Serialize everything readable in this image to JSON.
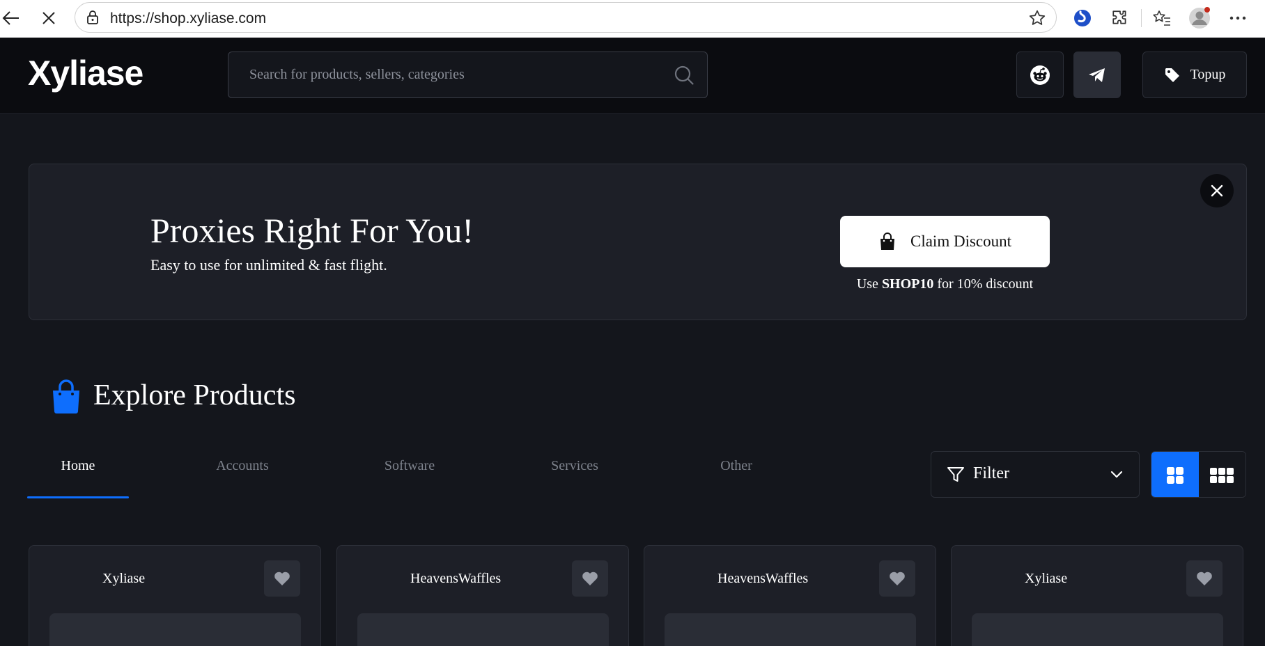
{
  "browser": {
    "url": "https://shop.xyliase.com"
  },
  "header": {
    "logo": "Xyliase",
    "search_placeholder": "Search for products, sellers, categories",
    "topup_label": "Topup"
  },
  "banner": {
    "title": "Proxies Right For You!",
    "subtitle": "Easy to use for unlimited & fast flight.",
    "claim_label": "Claim Discount",
    "note_prefix": "Use ",
    "note_code": "SHOP10",
    "note_suffix": " for 10% discount"
  },
  "explore": {
    "title": "Explore Products",
    "tabs": [
      {
        "label": "Home",
        "active": true
      },
      {
        "label": "Accounts",
        "active": false
      },
      {
        "label": "Software",
        "active": false
      },
      {
        "label": "Services",
        "active": false
      },
      {
        "label": "Other",
        "active": false
      }
    ],
    "filter_label": "Filter"
  },
  "products": [
    {
      "seller": "Xyliase"
    },
    {
      "seller": "HeavensWaffles"
    },
    {
      "seller": "HeavensWaffles"
    },
    {
      "seller": "Xyliase"
    }
  ],
  "colors": {
    "accent": "#0e6efd",
    "background": "#14161c",
    "header_background": "#0b0c10",
    "card_background": "#1d1f27"
  },
  "icons": {
    "browser": [
      "back-arrow-icon",
      "stop-loading-icon",
      "lock-icon",
      "favorite-star-icon",
      "copilot-icon",
      "extensions-icon",
      "favorites-icon",
      "profile-avatar-icon",
      "more-icon"
    ],
    "site": [
      "search-icon",
      "reddit-icon",
      "telegram-icon",
      "tag-icon",
      "shopping-bag-icon",
      "close-icon",
      "filter-funnel-icon",
      "chevron-down-icon",
      "grid-2-icon",
      "grid-3-icon",
      "heart-icon"
    ]
  }
}
